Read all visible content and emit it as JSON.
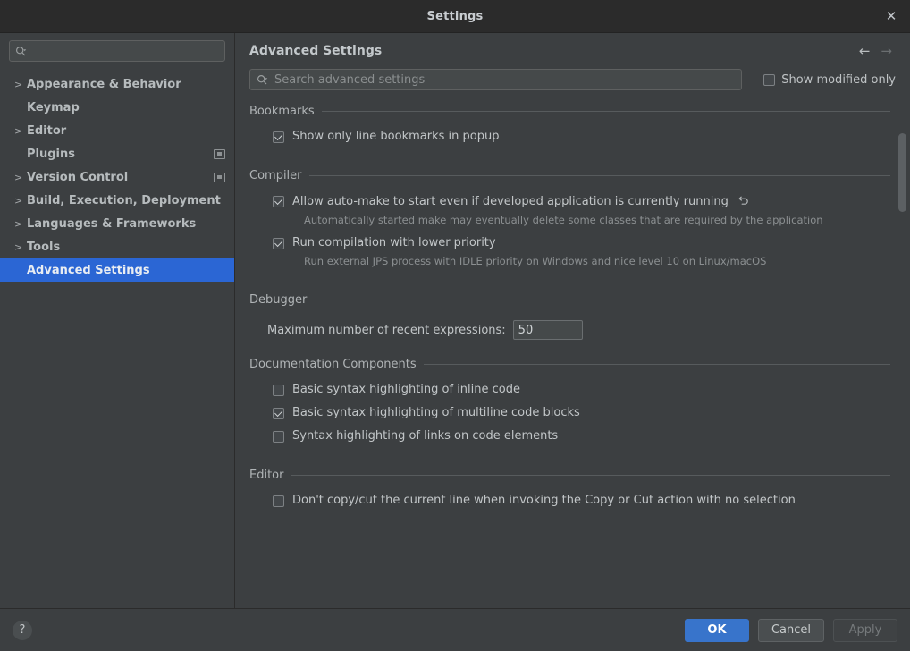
{
  "window": {
    "title": "Settings",
    "close_label": "✕"
  },
  "sidebar": {
    "search": {
      "placeholder": "",
      "value": ""
    },
    "items": [
      {
        "label": "Appearance & Behavior",
        "arrow": ">",
        "badge": false,
        "selected": false
      },
      {
        "label": "Keymap",
        "arrow": "",
        "badge": false,
        "selected": false
      },
      {
        "label": "Editor",
        "arrow": ">",
        "badge": false,
        "selected": false
      },
      {
        "label": "Plugins",
        "arrow": "",
        "badge": true,
        "selected": false
      },
      {
        "label": "Version Control",
        "arrow": ">",
        "badge": true,
        "selected": false
      },
      {
        "label": "Build, Execution, Deployment",
        "arrow": ">",
        "badge": false,
        "selected": false
      },
      {
        "label": "Languages & Frameworks",
        "arrow": ">",
        "badge": false,
        "selected": false
      },
      {
        "label": "Tools",
        "arrow": ">",
        "badge": false,
        "selected": false
      },
      {
        "label": "Advanced Settings",
        "arrow": "",
        "badge": false,
        "selected": true
      }
    ]
  },
  "content": {
    "title": "Advanced Settings",
    "nav": {
      "back": "←",
      "forward": "→"
    },
    "search": {
      "placeholder": "Search advanced settings",
      "value": ""
    },
    "show_modified_only": {
      "label": "Show modified only",
      "checked": false
    }
  },
  "sections": [
    {
      "title": "Bookmarks",
      "options": [
        {
          "label": "Show only line bookmarks in popup",
          "checked": true,
          "desc": "",
          "revert": false
        }
      ]
    },
    {
      "title": "Compiler",
      "options": [
        {
          "label": "Allow auto-make to start even if developed application is currently running",
          "checked": true,
          "desc": "Automatically started make may eventually delete some classes that are required by the application",
          "revert": true
        },
        {
          "label": "Run compilation with lower priority",
          "checked": true,
          "desc": "Run external JPS process with IDLE priority on Windows and nice level 10 on Linux/macOS",
          "revert": false
        }
      ]
    },
    {
      "title": "Debugger",
      "field": {
        "label": "Maximum number of recent expressions:",
        "value": "50"
      }
    },
    {
      "title": "Documentation Components",
      "options": [
        {
          "label": "Basic syntax highlighting of inline code",
          "checked": false,
          "desc": "",
          "revert": false
        },
        {
          "label": "Basic syntax highlighting of multiline code blocks",
          "checked": true,
          "desc": "",
          "revert": false
        },
        {
          "label": "Syntax highlighting of links on code elements",
          "checked": false,
          "desc": "",
          "revert": false
        }
      ]
    },
    {
      "title": "Editor",
      "options": [
        {
          "label": "Don't copy/cut the current line when invoking the Copy or Cut action with no selection",
          "checked": false,
          "desc": "",
          "revert": false
        }
      ]
    }
  ],
  "footer": {
    "help": "?",
    "ok": "OK",
    "cancel": "Cancel",
    "apply": "Apply"
  },
  "colors": {
    "accent": "#3874cb",
    "selection": "#2b66d4",
    "background": "#3c3f41",
    "titlebar": "#2b2b2b",
    "text": "#c2c6c8"
  }
}
